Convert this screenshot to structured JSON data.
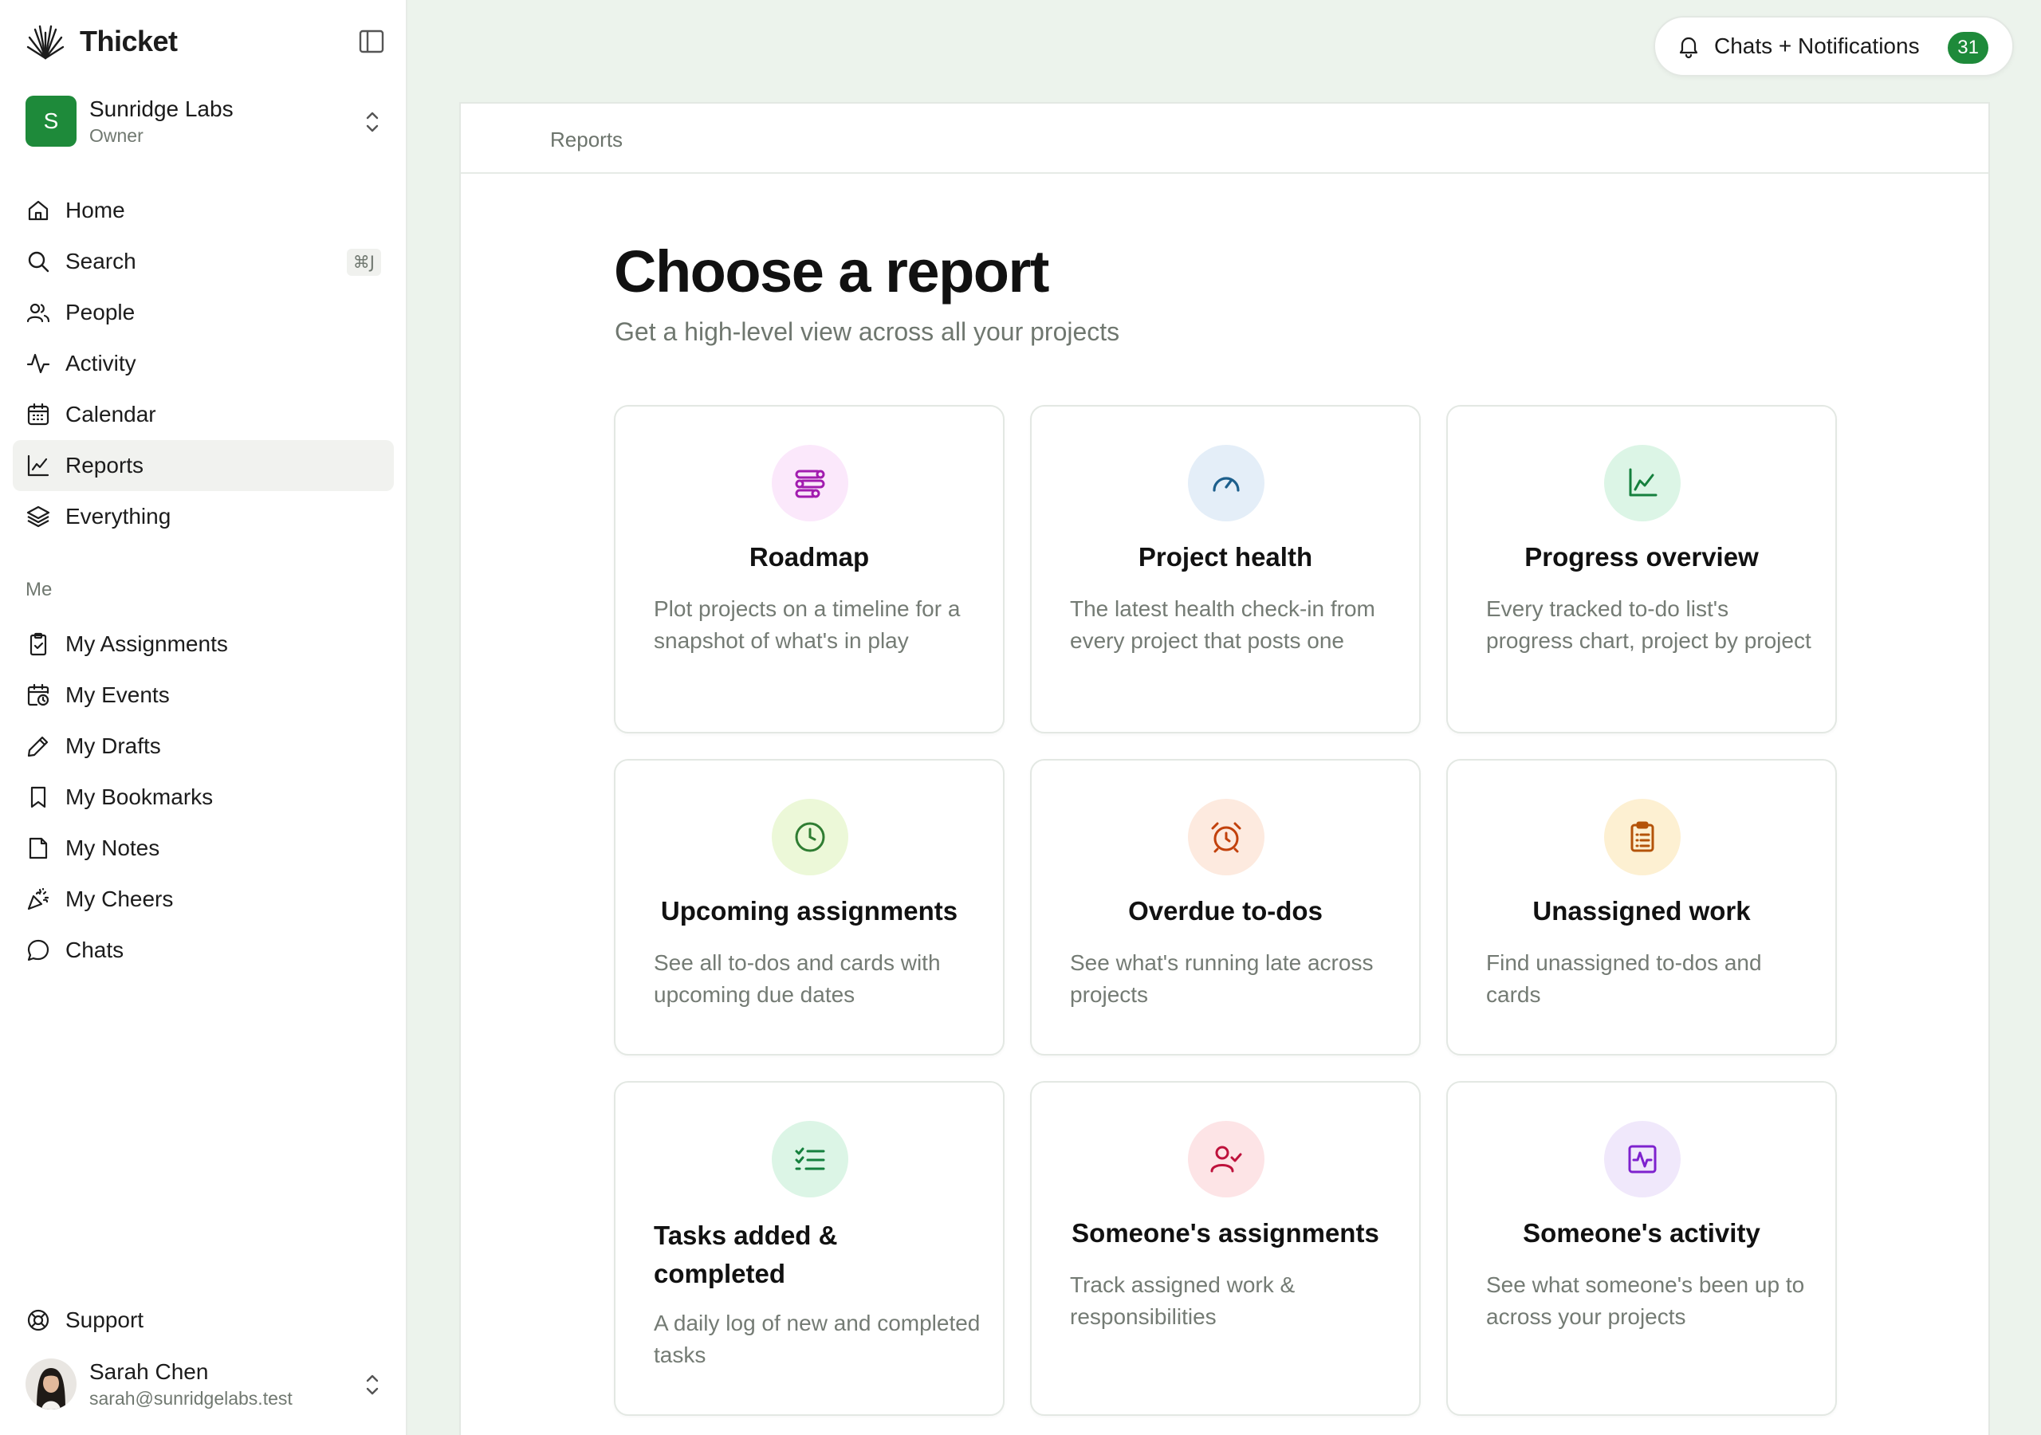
{
  "sidebar": {
    "brand": "Thicket",
    "account": {
      "initial": "S",
      "name": "Sunridge Labs",
      "role": "Owner"
    },
    "nav": [
      {
        "label": "Home",
        "icon": "home-icon"
      },
      {
        "label": "Search",
        "icon": "search-icon",
        "shortcut": "⌘J"
      },
      {
        "label": "People",
        "icon": "people-icon"
      },
      {
        "label": "Activity",
        "icon": "activity-icon"
      },
      {
        "label": "Calendar",
        "icon": "calendar-icon"
      },
      {
        "label": "Reports",
        "icon": "chart-icon",
        "active": true
      },
      {
        "label": "Everything",
        "icon": "layers-icon"
      }
    ],
    "me_label": "Me",
    "me_items": [
      {
        "label": "My Assignments",
        "icon": "clipboard-icon"
      },
      {
        "label": "My Events",
        "icon": "calendar-clock-icon"
      },
      {
        "label": "My Drafts",
        "icon": "pencil-icon"
      },
      {
        "label": "My Bookmarks",
        "icon": "bookmark-icon"
      },
      {
        "label": "My Notes",
        "icon": "note-icon"
      },
      {
        "label": "My Cheers",
        "icon": "party-icon"
      },
      {
        "label": "Chats",
        "icon": "chat-bubble-icon"
      }
    ],
    "support_label": "Support",
    "user": {
      "name": "Sarah Chen",
      "email": "sarah@sunridgelabs.test"
    }
  },
  "topbar": {
    "notifications_label": "Chats + Notifications",
    "notifications_count": "31"
  },
  "main": {
    "breadcrumb": "Reports",
    "title": "Choose a report",
    "subtitle": "Get a high-level view across all your projects",
    "cards": [
      {
        "title": "Roadmap",
        "description": "Plot projects on a timeline for a snapshot of what's in play",
        "icon": "route-icon",
        "icon_color": "#a21caf",
        "icon_bg": "#fbe8fb"
      },
      {
        "title": "Project health",
        "description": "The latest health check-in from every project that posts one",
        "icon": "gauge-icon",
        "icon_color": "#1d5f8c",
        "icon_bg": "#e4eef8"
      },
      {
        "title": "Progress overview",
        "description": "Every tracked to-do list's progress chart, project by project",
        "icon": "line-chart-icon",
        "icon_color": "#15803d",
        "icon_bg": "#dcf5e6"
      },
      {
        "title": "Upcoming assignments",
        "description": "See all to-dos and cards with upcoming due dates",
        "icon": "clock-icon",
        "icon_color": "#2f7d32",
        "icon_bg": "#ecf8d8"
      },
      {
        "title": "Overdue to-dos",
        "description": "See what's running late across projects",
        "icon": "alarm-clock-icon",
        "icon_color": "#c2410c",
        "icon_bg": "#fdeadf"
      },
      {
        "title": "Unassigned work",
        "description": "Find unassigned to-dos and cards",
        "icon": "clipboard-list-icon",
        "icon_color": "#b45309",
        "icon_bg": "#fdf0d2"
      },
      {
        "title": "Tasks added & completed",
        "description": "A daily log of new and completed tasks",
        "icon": "list-checks-icon",
        "icon_color": "#15803d",
        "icon_bg": "#dcf5e6"
      },
      {
        "title": "Someone's assignments",
        "description": "Track assigned work & responsibilities",
        "icon": "user-check-icon",
        "icon_color": "#be123c",
        "icon_bg": "#fde4e6"
      },
      {
        "title": "Someone's activity",
        "description": "See what someone's been up to across your projects",
        "icon": "activity-square-icon",
        "icon_color": "#7e22ce",
        "icon_bg": "#f0e8fb"
      }
    ]
  }
}
